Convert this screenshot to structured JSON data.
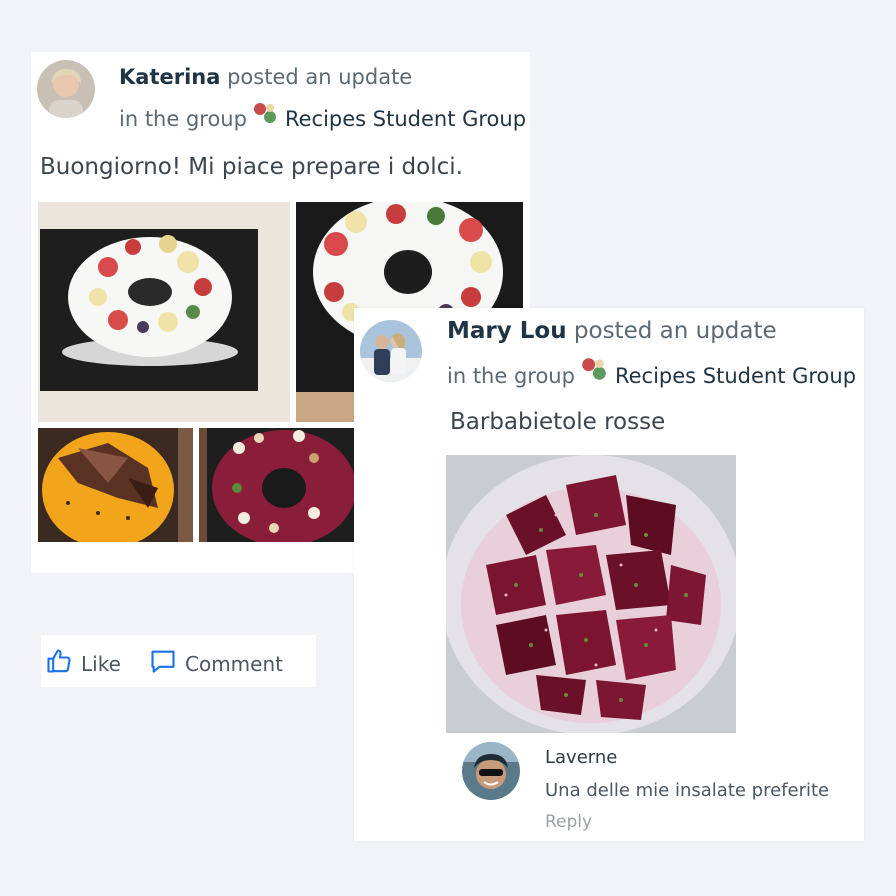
{
  "posts": [
    {
      "author": "Katerina",
      "action": "posted an update",
      "in_group_prefix": "in the group",
      "group_name": "Recipes Student Group",
      "text": "Buongiorno! Mi piace prepare i dolci."
    },
    {
      "author": "Mary Lou",
      "action": "posted an update",
      "in_group_prefix": "in the group",
      "group_name": "Recipes Student Group",
      "text": "Barbabietole rosse",
      "comment": {
        "author": "Laverne",
        "text": "Una delle mie insalate preferite",
        "reply_label": "Reply"
      }
    }
  ],
  "actions": {
    "like_label": "Like",
    "comment_label": "Comment"
  },
  "colors": {
    "accent": "#1a73e8",
    "page_background": "#f1f3f6"
  },
  "icons": [
    "thumbs-up-icon",
    "comment-bubble-icon"
  ]
}
